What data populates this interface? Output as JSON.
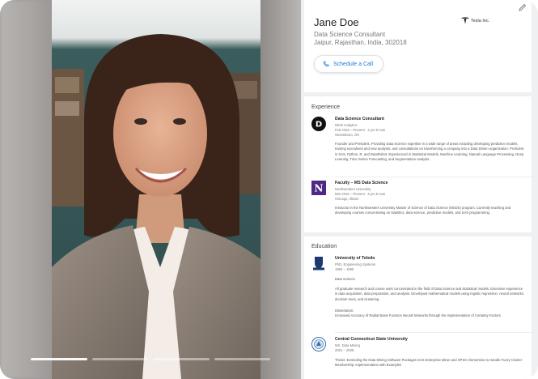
{
  "profile": {
    "name": "Jane Doe",
    "title": "Data Science Consultant",
    "location": "Jaipur, Rajasthan, India, 302018",
    "company": "Tesla Inc.",
    "schedule_label": "Schedule a Call"
  },
  "experience": {
    "heading": "Experience",
    "items": [
      {
        "title": "Data Science Consultant",
        "org": "DKW Analytics",
        "dates": "Feb 2019 – Present · 2 yrs 6 mos",
        "place": "Streetsboro, OH",
        "desc": "Founder and President. Providing Data Science expertise in a wide range of areas including developing predictive models, training executives and new analysts, and consultations on transforming a company into a Data Driven organization. Proficient in SAS, Python, R, and DataRobot. Experienced in Statistical Models, Machine Learning, Natural Language Processing, Deep Learning, Time Series Forecasting, and Segmentation analysis."
      },
      {
        "title": "Faculty – MS Data Science",
        "org": "Northwestern University",
        "dates": "Mar 2015 – Present · 6 yrs 5 mos",
        "place": "Chicago, Illinois",
        "desc": "Instructor in the Northwestern University Master of Science of Data Science (MSDS) program. Currently teaching and developing courses concentrating on statistics, data science, predictive models, and SAS programming."
      }
    ]
  },
  "education": {
    "heading": "Education",
    "items": [
      {
        "school": "University of Toledo",
        "degree": "PhD, Engineering Systems",
        "years": "1992 – 1995",
        "field": "Data Science",
        "desc": "All graduate research and course work concentrated in the field of Data Science and Statistical models. Extensive experience in data acquisition, data preparation, and analysis. Developed mathematical models using logistic regression, neural networks, decision trees, and clustering.",
        "dissertation_label": "Dissertation:",
        "dissertation": "Increased Accuracy of Radial Basis Function Neural Networks through the Implementation of Certainty Factors"
      },
      {
        "school": "Central Connecticut State University",
        "degree": "MS, Data Mining",
        "years": "2001 – 2008",
        "desc": "Thesis: Extending the Data Mining Software Packages SAS Enterprise Miner and SPSS Clementine to Handle Fuzzy Cluster Membership: Implementation with Examples"
      }
    ]
  },
  "video": {
    "progress_segments": 4,
    "active_segment": 0
  },
  "colors": {
    "accent": "#1e7bd6",
    "panel_bg": "#eef0f2"
  }
}
